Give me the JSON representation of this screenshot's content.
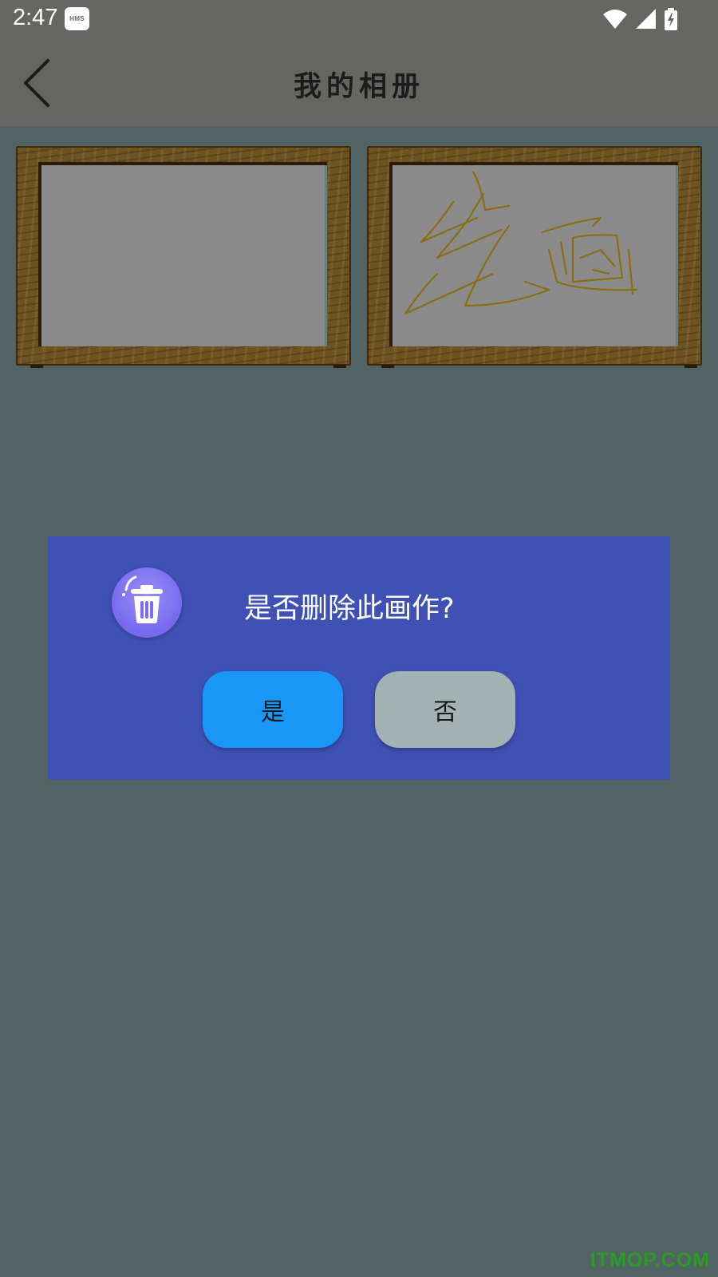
{
  "status_bar": {
    "time": "2:47",
    "badge": "HMS",
    "icons": [
      "wifi-icon",
      "signal-icon",
      "battery-charging-icon"
    ]
  },
  "app_bar": {
    "back_icon": "chevron-left-icon",
    "title": "我的相册"
  },
  "gallery": {
    "items": [
      {
        "name": "painting-1"
      },
      {
        "name": "painting-2"
      }
    ]
  },
  "dialog": {
    "icon": "trash-icon",
    "message": "是否删除此画作?",
    "confirm_label": "是",
    "cancel_label": "否",
    "colors": {
      "background": "#3f51b5",
      "confirm": "#1997f9",
      "cancel": "#a3b2b3"
    }
  },
  "watermark": "ITMOP.COM"
}
